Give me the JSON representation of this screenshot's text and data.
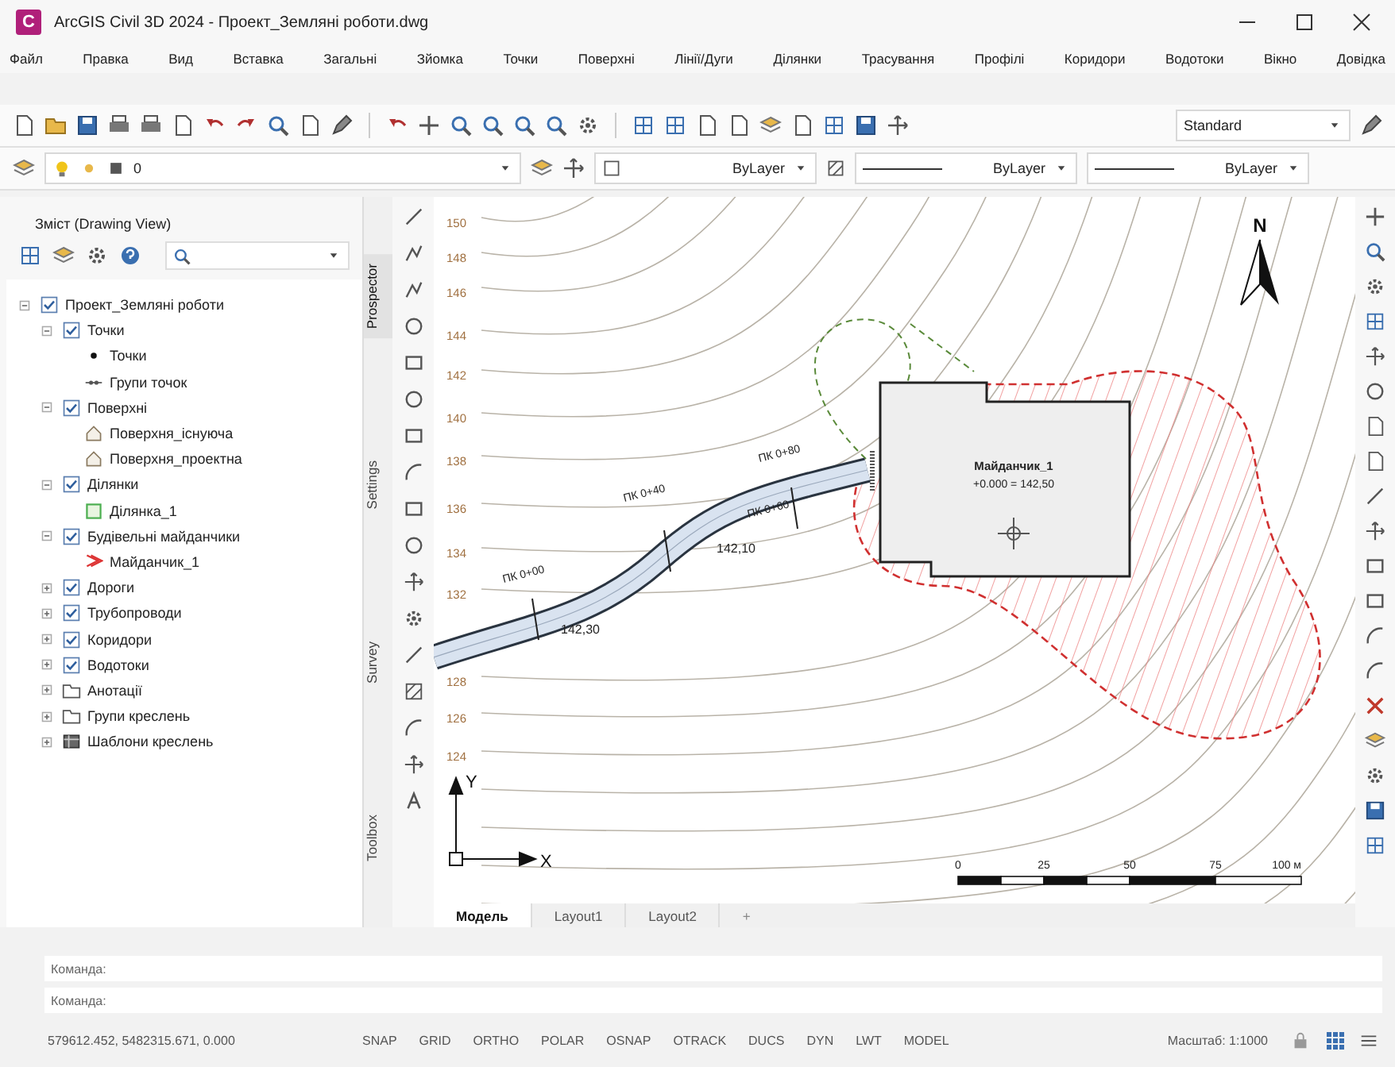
{
  "window": {
    "app_icon": "C",
    "title": "ArcGIS Civil 3D 2024 - Проект_Земляні роботи.dwg"
  },
  "menu": [
    "Файл",
    "Правка",
    "Вид",
    "Вставка",
    "Загальні",
    "Зйомка",
    "Точки",
    "Поверхні",
    "Лінії/Дуги",
    "Ділянки",
    "Трасування",
    "Профілі",
    "Коридори",
    "Водотоки",
    "Вікно",
    "Довідка"
  ],
  "toolbar": {
    "style": "Standard"
  },
  "layer_bar": {
    "layer": "0",
    "color_setting": "ByLayer",
    "linetype": "ByLayer",
    "lineweight": "ByLayer"
  },
  "panel": {
    "title": "Зміст (Drawing View)",
    "tree": [
      {
        "label": "Проект_Земляні роботи",
        "kind": "checkbox",
        "checked": true,
        "expanded": true,
        "children": [
          {
            "label": "Точки",
            "kind": "checkbox",
            "checked": true,
            "expanded": true,
            "children": [
              {
                "label": "Точки",
                "kind": "point"
              },
              {
                "label": "Групи точок",
                "kind": "point-group"
              }
            ]
          },
          {
            "label": "Поверхні",
            "kind": "checkbox",
            "checked": true,
            "expanded": true,
            "children": [
              {
                "label": "Поверхня_існуюча",
                "kind": "surface"
              },
              {
                "label": "Поверхня_проектна",
                "kind": "surface"
              }
            ]
          },
          {
            "label": "Ділянки",
            "kind": "checkbox",
            "checked": true,
            "expanded": true,
            "children": [
              {
                "label": "Ділянка_1",
                "kind": "parcel"
              }
            ]
          },
          {
            "label": "Будівельні майданчики",
            "kind": "checkbox",
            "checked": true,
            "expanded": true,
            "children": [
              {
                "label": "Майданчик_1",
                "kind": "grading"
              }
            ]
          },
          {
            "label": "Дороги",
            "kind": "checkbox",
            "checked": true,
            "expanded": false
          },
          {
            "label": "Трубопроводи",
            "kind": "checkbox",
            "checked": true,
            "expanded": false
          },
          {
            "label": "Коридори",
            "kind": "checkbox",
            "checked": true,
            "expanded": false
          },
          {
            "label": "Водотоки",
            "kind": "checkbox",
            "checked": true,
            "expanded": false
          },
          {
            "label": "Анотації",
            "kind": "folder",
            "expanded": false
          },
          {
            "label": "Групи креслень",
            "kind": "folder",
            "expanded": false
          },
          {
            "label": "Шаблони креслень",
            "kind": "template",
            "expanded": false
          }
        ]
      }
    ]
  },
  "side_tabs": [
    {
      "label": "Prospector",
      "selected": true
    },
    {
      "label": "Settings",
      "selected": false
    },
    {
      "label": "Survey",
      "selected": false
    },
    {
      "label": "Toolbox",
      "selected": false
    }
  ],
  "canvas": {
    "contour_labels": [
      "150",
      "148",
      "146",
      "144",
      "142",
      "140",
      "138",
      "136",
      "134",
      "132",
      "128",
      "126",
      "124"
    ],
    "stations": [
      "ПК 0+00",
      "ПК 0+40",
      "ПК 0+80",
      "ПК 0+60"
    ],
    "elevations": [
      "142,10",
      "142,30"
    ],
    "platform": {
      "name": "Майданчик_1",
      "elevation": "+0.000 = 142,50"
    },
    "north": "N",
    "axis_y": "Y",
    "axis_x": "X",
    "scale_labels": [
      "0",
      "25",
      "50",
      "75",
      "100 м"
    ]
  },
  "layout_tabs": [
    {
      "label": "Модель",
      "selected": true
    },
    {
      "label": "Layout1",
      "selected": false
    },
    {
      "label": "Layout2",
      "selected": false
    }
  ],
  "layout_add": "+",
  "command_lines": [
    "Команда:",
    "Команда:"
  ],
  "status": {
    "coords": "579612.452, 5482315.671, 0.000",
    "toggles": [
      "SNAP",
      "GRID",
      "ORTHO",
      "POLAR",
      "OSNAP",
      "OTRACK",
      "DUCS",
      "DYN",
      "LWT",
      "MODEL"
    ],
    "scale": "Масштаб: 1:1000"
  }
}
